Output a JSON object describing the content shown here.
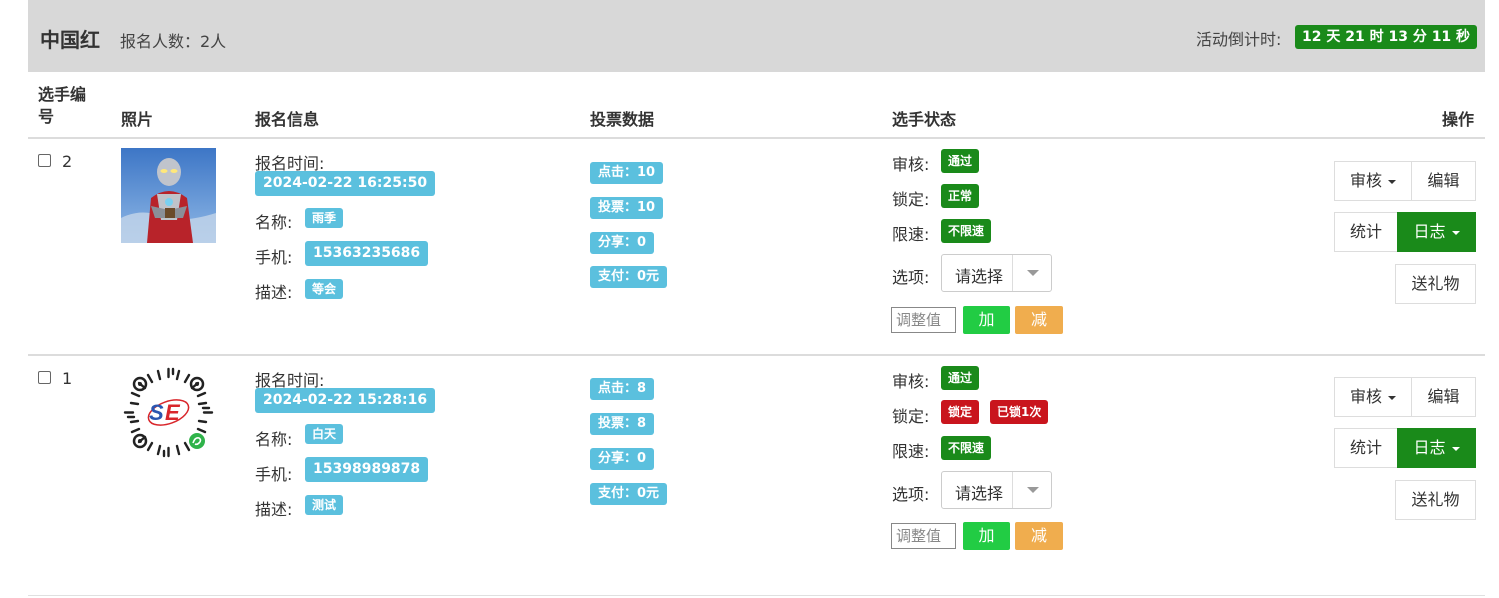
{
  "header": {
    "title": "中国红",
    "count": "报名人数：2人",
    "countdown_label": "活动倒计时:",
    "countdown": "12 天 21 时 13 分 11 秒"
  },
  "columns": {
    "id": "选手编号",
    "photo": "照片",
    "info": "报名信息",
    "votes": "投票数据",
    "status": "选手状态",
    "ops": "操作"
  },
  "labels": {
    "signup_time": "报名时间:",
    "name": "名称:",
    "phone": "手机:",
    "desc": "描述:",
    "review": "审核:",
    "lock": "锁定:",
    "speed": "限速:",
    "option": "选项:",
    "select_placeholder": "请选择",
    "adjust_placeholder": "调整值",
    "add": "加",
    "sub": "减",
    "btn_review": "审核",
    "btn_edit": "编辑",
    "btn_stats": "统计",
    "btn_log": "日志",
    "btn_gift": "送礼物"
  },
  "rows": [
    {
      "id": "2",
      "time": "2024-02-22 16:25:50",
      "name": "雨季",
      "phone": "15363235686",
      "desc": "等会",
      "clicks": "点击：10",
      "votes": "投票：10",
      "shares": "分享：0",
      "pay": "支付：0元",
      "review": "通过",
      "lock": "正常",
      "lock_extra": "",
      "speed": "不限速"
    },
    {
      "id": "1",
      "time": "2024-02-22 15:28:16",
      "name": "白天",
      "phone": "15398989878",
      "desc": "测试",
      "clicks": "点击：8",
      "votes": "投票：8",
      "shares": "分享：0",
      "pay": "支付：0元",
      "review": "通过",
      "lock": "锁定",
      "lock_extra": "已锁1次",
      "speed": "不限速"
    }
  ],
  "colors": {
    "header_bg": "#d8d8d8",
    "info": "#5bc0de",
    "success": "#1a8a1a",
    "danger": "#c9151d",
    "add": "#22cc44",
    "warning": "#f0ad4e"
  }
}
